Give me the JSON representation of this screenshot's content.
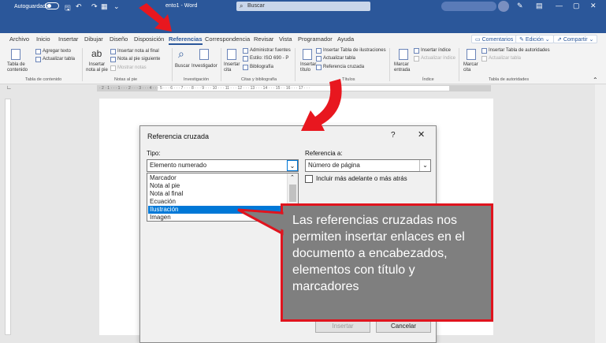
{
  "titlebar": {
    "autosave_label": "Autoguardado",
    "doc_title": "ento1 - Word",
    "search_placeholder": "Buscar",
    "min_glyph": "—",
    "restore_glyph": "▢",
    "close_glyph": "✕",
    "pen_glyph": "✎",
    "layout_glyph": "▤"
  },
  "tabs": [
    "Archivo",
    "Inicio",
    "Insertar",
    "Dibujar",
    "Diseño",
    "Disposición",
    "Referencias",
    "Correspondencia",
    "Revisar",
    "Vista",
    "Programador",
    "Ayuda"
  ],
  "active_tab": "Referencias",
  "tab_buttons": {
    "comments": "Comentarios",
    "editing": "Edición",
    "share": "Compartir"
  },
  "ribbon": {
    "toc": {
      "big": "Tabla de contenido",
      "add_text": "Agregar texto",
      "update_table": "Actualizar tabla",
      "group": "Tabla de contenido"
    },
    "footnotes": {
      "big": "Insertar nota al pie",
      "endnote": "Insertar nota al final",
      "next": "Nota al pie siguiente",
      "show": "Mostrar notas",
      "group": "Notas al pie"
    },
    "research": {
      "search": "Buscar",
      "researcher": "Investigador",
      "group": "Investigación"
    },
    "citations": {
      "insert": "Insertar cita",
      "manage": "Administrar fuentes",
      "style": "Estilo: ISO 690 - P",
      "biblio": "Bibliografía",
      "group": "Citas y bibliografía"
    },
    "captions": {
      "insert": "Insertar título",
      "table_fig": "Insertar Tabla de ilustraciones",
      "update": "Actualizar tabla",
      "crossref": "Referencia cruzada",
      "group": "Títulos"
    },
    "index": {
      "mark": "Marcar entrada",
      "insert": "Insertar índice",
      "update": "Actualizar índice",
      "group": "Índice"
    },
    "authorities": {
      "mark": "Marcar cita",
      "insert": "Insertar Tabla de autoridades",
      "update": "Actualizar tabla",
      "group": "Tabla de autoridades"
    }
  },
  "ruler": {
    "marks": "· 2 · 1 · · · 1 · · · 2 · · · 3 · · · 4 · · · 5 · · · 6 · · · 7 · · · 8 · · · 9 · · · 10 · · · 11 · · · 12 · · · 13 · · · 14 · · · 15 · · 16 · · · 17 · · ·"
  },
  "dialog": {
    "title": "Referencia cruzada",
    "help_glyph": "?",
    "close_glyph": "✕",
    "tipo_label": "Tipo:",
    "tipo_value": "Elemento numerado",
    "ref_label": "Referencia a:",
    "ref_value": "Número de página",
    "include_label": "Incluir más adelante o más atrás",
    "list_items": [
      "Marcador",
      "Nota al pie",
      "Nota al final",
      "Ecuación",
      "Ilustración",
      "Imagen"
    ],
    "selected_item": "Ilustración",
    "insert_button": "Insertar",
    "cancel_button": "Cancelar"
  },
  "callout": {
    "text": "Las referencias cruzadas nos permiten insertar enlaces en el documento a encabezados, elementos con título y marcadores",
    "border_color": "#e0141e",
    "background": "#7f7f7f"
  },
  "colors": {
    "word_blue": "#2b579a",
    "arrow_red": "#e8171f",
    "selection_blue": "#0078d7"
  }
}
